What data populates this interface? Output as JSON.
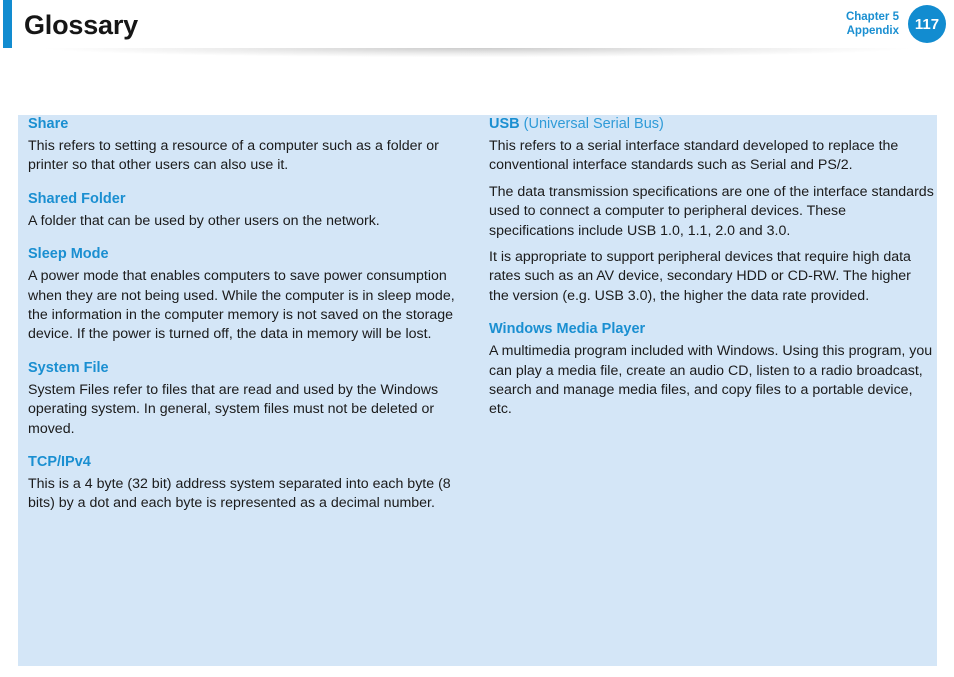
{
  "header": {
    "title": "Glossary",
    "chapter_line1": "Chapter 5",
    "chapter_line2": "Appendix",
    "page_number": "117",
    "accent_color": "#128cd0",
    "title_color": "#161616"
  },
  "panel": {
    "background_color": "#d4e6f7",
    "term_color": "#1a8fd1",
    "body_color": "#1b1b1b"
  },
  "glossary": {
    "left_column": [
      {
        "term": "Share",
        "term_expansion": "",
        "definitions": [
          "This refers to setting a resource of a computer such as a folder or printer so that other users can also use it."
        ]
      },
      {
        "term": "Shared Folder",
        "term_expansion": "",
        "definitions": [
          "A folder that can be used by other users on the network."
        ]
      },
      {
        "term": "Sleep Mode",
        "term_expansion": "",
        "definitions": [
          "A power mode that enables computers to save power consumption when they are not being used. While the computer is in sleep mode, the information in the computer memory is not saved on the storage device. If the power is turned off, the data in memory will be lost."
        ]
      },
      {
        "term": "System File",
        "term_expansion": "",
        "definitions": [
          "System Files refer to files that are read and used by the Windows operating system. In general, system files must not be deleted or moved."
        ]
      },
      {
        "term": "TCP/IPv4",
        "term_expansion": "",
        "definitions": [
          "This is a 4 byte (32 bit) address system separated into each byte (8 bits) by a dot and each byte is represented as a decimal number."
        ]
      }
    ],
    "right_column": [
      {
        "term": "USB",
        "term_expansion": "(Universal Serial Bus)",
        "definitions": [
          "This refers to a serial interface standard developed to replace the conventional interface standards such as Serial and PS/2.",
          "The data transmission specifications are one of the interface standards used to connect a computer to peripheral devices. These specifications include USB 1.0, 1.1, 2.0 and 3.0.",
          "It is appropriate to support peripheral devices that require high data rates such as an AV device, secondary HDD or CD-RW. The higher the version (e.g. USB 3.0), the higher the data rate provided."
        ]
      },
      {
        "term": "Windows Media Player",
        "term_expansion": "",
        "definitions": [
          "A multimedia program included with Windows. Using this program, you can play a media file, create an audio CD, listen to a radio broadcast, search and manage media files, and copy files to a portable device, etc."
        ]
      }
    ]
  }
}
